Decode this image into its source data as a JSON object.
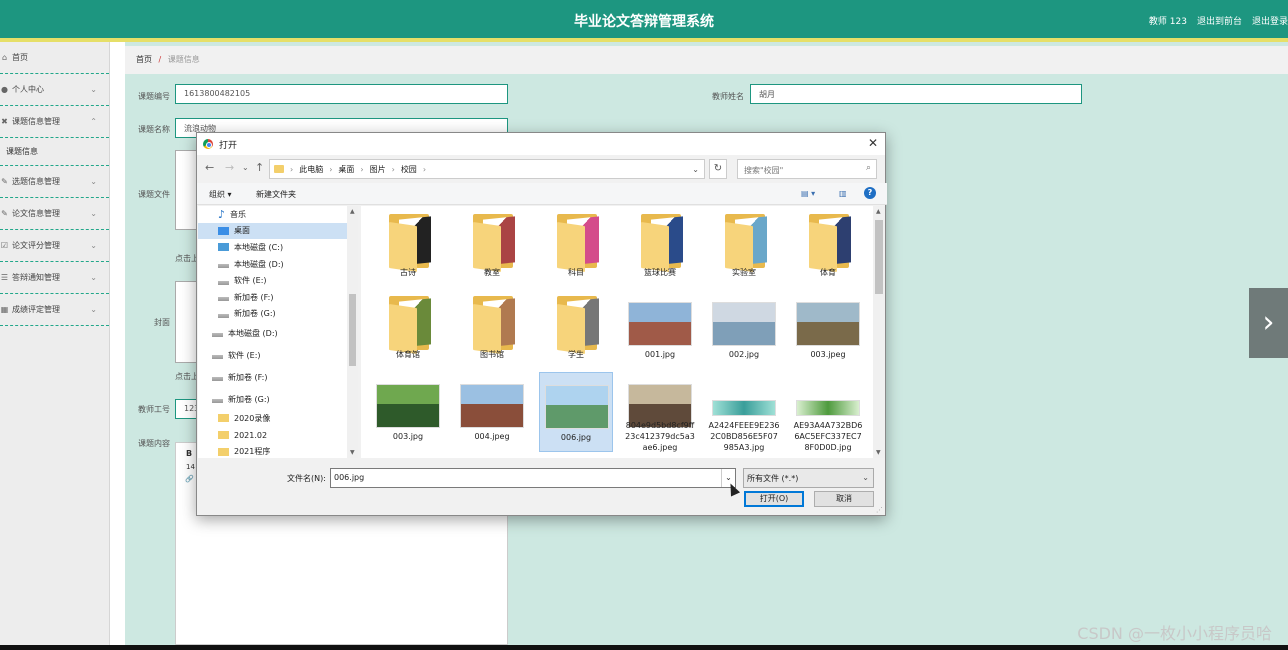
{
  "app": {
    "title": "毕业论文答辩管理系统",
    "user": "教师 123",
    "back_to_admin": "退出到前台",
    "logout": "退出登录"
  },
  "sidebar": {
    "items": [
      {
        "icon": "home-icon",
        "label": "首页"
      },
      {
        "icon": "user-icon",
        "label": "个人中心"
      },
      {
        "icon": "topic-icon",
        "label": "课题信息管理"
      },
      {
        "icon": "select-icon",
        "label": "选题信息管理"
      },
      {
        "icon": "paper-icon",
        "label": "论文信息管理"
      },
      {
        "icon": "grade-icon",
        "label": "论文评分管理"
      },
      {
        "icon": "notice-icon",
        "label": "答辩通知管理"
      },
      {
        "icon": "score-icon",
        "label": "成绩评定管理"
      }
    ],
    "sub_item": "课题信息"
  },
  "breadcrumb": {
    "home": "首页",
    "sep": "/",
    "current": "课题信息"
  },
  "form": {
    "topic_no_label": "课题编号",
    "topic_no_value": "1613800482105",
    "teacher_name_label": "教师姓名",
    "teacher_name_value": "胡月",
    "topic_name_label": "课题名称",
    "topic_name_value": "流浪动物",
    "topic_file_label": "课题文件",
    "cover_label": "封面",
    "click_upload": "点击上",
    "teacher_no_label": "教师工号",
    "teacher_no_value": "123",
    "content_label": "课题内容",
    "editor_bold": "B",
    "editor_size": "14",
    "editor_link": "🔗"
  },
  "dialog": {
    "title": "打开",
    "path": [
      "此电脑",
      "桌面",
      "图片",
      "校园"
    ],
    "search_placeholder": "搜索\"校园\"",
    "organize": "组织 ▾",
    "new_folder": "新建文件夹",
    "nav_items": [
      {
        "icon": "music",
        "label": "音乐"
      },
      {
        "icon": "desk",
        "label": "桌面",
        "selected": true
      },
      {
        "icon": "drive",
        "label": "本地磁盘 (C:)"
      },
      {
        "icon": "drive",
        "label": "本地磁盘 (D:)"
      },
      {
        "icon": "drive",
        "label": "软件 (E:)"
      },
      {
        "icon": "drive",
        "label": "新加卷 (F:)"
      },
      {
        "icon": "drive",
        "label": "新加卷 (G:)"
      },
      {
        "icon": "drive",
        "label": "本地磁盘 (D:)"
      },
      {
        "icon": "drive",
        "label": "软件 (E:)"
      },
      {
        "icon": "drive",
        "label": "新加卷 (F:)"
      },
      {
        "icon": "drive",
        "label": "新加卷 (G:)"
      },
      {
        "icon": "fold",
        "label": "2020录像"
      },
      {
        "icon": "fold",
        "label": "2021.02"
      },
      {
        "icon": "fold",
        "label": "2021程序"
      }
    ],
    "files": [
      {
        "name": "古诗",
        "kind": "folder",
        "accent": "#222"
      },
      {
        "name": "教室",
        "kind": "folder",
        "accent": "#a44"
      },
      {
        "name": "科目",
        "kind": "folder",
        "accent": "#d44c8a"
      },
      {
        "name": "篮球比赛",
        "kind": "folder",
        "accent": "#2a4b8a"
      },
      {
        "name": "实验室",
        "kind": "folder",
        "accent": "#6aa7c9"
      },
      {
        "name": "体育",
        "kind": "folder",
        "accent": "#2d3f70"
      },
      {
        "name": "体育馆",
        "kind": "folder",
        "accent": "#6a8a3a"
      },
      {
        "name": "图书馆",
        "kind": "folder",
        "accent": "#b07a50"
      },
      {
        "name": "学生",
        "kind": "folder",
        "accent": "#777"
      },
      {
        "name": "001.jpg",
        "kind": "image",
        "colors": [
          "#8fb4d8",
          "#a05a48"
        ]
      },
      {
        "name": "002.jpg",
        "kind": "image",
        "colors": [
          "#cfd8e2",
          "#7f9fb8"
        ]
      },
      {
        "name": "003.jpeg",
        "kind": "image",
        "colors": [
          "#9fb9c9",
          "#7a6a4a"
        ]
      },
      {
        "name": "003.jpg",
        "kind": "image",
        "colors": [
          "#6fa84f",
          "#2e5a2a"
        ]
      },
      {
        "name": "004.jpeg",
        "kind": "image",
        "colors": [
          "#9bc0e2",
          "#8a4e3a"
        ]
      },
      {
        "name": "006.jpg",
        "kind": "image",
        "selected": true,
        "colors": [
          "#aed3ef",
          "#5f9a6a"
        ]
      },
      {
        "name": "804e9d5bd8cf9ff23c412379dc5a3ae6.jpeg",
        "kind": "image",
        "colors": [
          "#c6b89c",
          "#5f4a3a"
        ]
      },
      {
        "name": "A2424FEEE9E2362C0BD856E5F07985A3.jpg",
        "kind": "strip",
        "colors": [
          "#9fe0d6",
          "#3a9e9a"
        ]
      },
      {
        "name": "AE93A4A732BD66AC5EFC337EC78F0D0D.jpg",
        "kind": "strip",
        "colors": [
          "#d9efcf",
          "#4e9a3d"
        ]
      }
    ],
    "filename_label": "文件名(N):",
    "filename_value": "006.jpg",
    "filter": "所有文件 (*.*)",
    "open": "打开(O)",
    "cancel": "取消"
  },
  "watermark": "CSDN @一枚小小程序员哈"
}
